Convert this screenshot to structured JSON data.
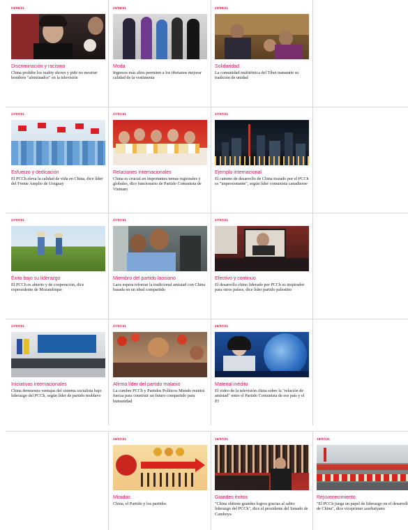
{
  "cards": [
    {
      "date": "03/06/21",
      "category": "Discriminación y racismo",
      "headline": "China prohíbe los reality shows y pide no mostrar hombres \"afeminados\" en la televisión",
      "thumb": "man-portrait-photo"
    },
    {
      "date": "20/08/21",
      "category": "Moda",
      "headline": "Ingresos más altos permiten a los tibetanos mejorar calidad de la vestimenta",
      "thumb": "fashion-runway-photo"
    },
    {
      "date": "20/08/21",
      "category": "Solidaridad",
      "headline": "La comunidad multiétnica del Tíbet transmite su tradición de unidad",
      "thumb": "tibetan-family-photo"
    },
    {
      "date": "27/07/21",
      "category": "Esfuerzo y dedicación",
      "headline": "El PCCh eleva la calidad de vida en China, dice líder del Frente Amplio de Uruguay",
      "thumb": "flag-waving-crowd-photo"
    },
    {
      "date": "27/07/21",
      "category": "Relaciones internacionales",
      "headline": "China es crucial en importantes temas regionales y globales, dice funcionario de Partido Comunista de Vietnam",
      "thumb": "girls-group-photo"
    },
    {
      "date": "27/07/21",
      "category": "Ejemplo internacional",
      "headline": "El camino de desarrollo de China trazado por el PCCh es \"impresionante\", según líder comunista canadiense",
      "thumb": "city-night-skyline-photo"
    },
    {
      "date": "27/07/21",
      "category": "Éxito bajo su liderazgo",
      "headline": "El PCCh es abierto y de cooperación, dice expresidente de Mozambique",
      "thumb": "farmers-field-photo"
    },
    {
      "date": "27/07/21",
      "category": "Miembro del partido laosiano",
      "headline": "Laos espera reforzar la tradicional amistad con China basada en un ideal compartido",
      "thumb": "children-smiling-photo"
    },
    {
      "date": "27/07/21",
      "category": "Efectivo y continuo",
      "headline": "El desarrollo chino liderado por PCCh es inspirador para otros países, dice líder partido palestino",
      "thumb": "video-conference-photo"
    },
    {
      "date": "27/07/21",
      "category": "Iniciativas internacionales",
      "headline": "China demuestra ventajas del sistema socialista bajo liderazgo del PCCh, según líder de partido moldavo",
      "thumb": "conference-hall-photo"
    },
    {
      "date": "27/07/21",
      "category": "Afirma líder del partido malasio",
      "headline": "La cumbre PCCh y Partidos Políticos Mundo reunirá fuerza para construir un futuro compartido para humanidad",
      "thumb": "lanterns-crowd-photo"
    },
    {
      "date": "26/07/21",
      "category": "Material inédito",
      "headline": "El video de la televisión china sobre la \"relación de amistad\" entre el Partido Comunista de ese país y el PJ",
      "thumb": "news-anchor-photo"
    }
  ],
  "bottom_cards": [
    {
      "date": "16/07/21",
      "category": "Miradas",
      "headline": "China, el Partido y los partidos",
      "thumb": "illustration-arrow-photo"
    },
    {
      "date": "16/07/21",
      "category": "Grandes éxitos",
      "headline": "\"China obtiene grandes logros gracias al sabio liderazgo del PCCh\", dice el presidente del Senado de Camboya",
      "thumb": "leader-crowd-photo"
    },
    {
      "date": "16/07/21",
      "category": "Rejuvenecimiento",
      "headline": "\"El PCCh juega un papel de liderazgo en el desarrollo de China\", dice viceprimer azerbaiyano",
      "thumb": "square-parade-photo"
    }
  ]
}
